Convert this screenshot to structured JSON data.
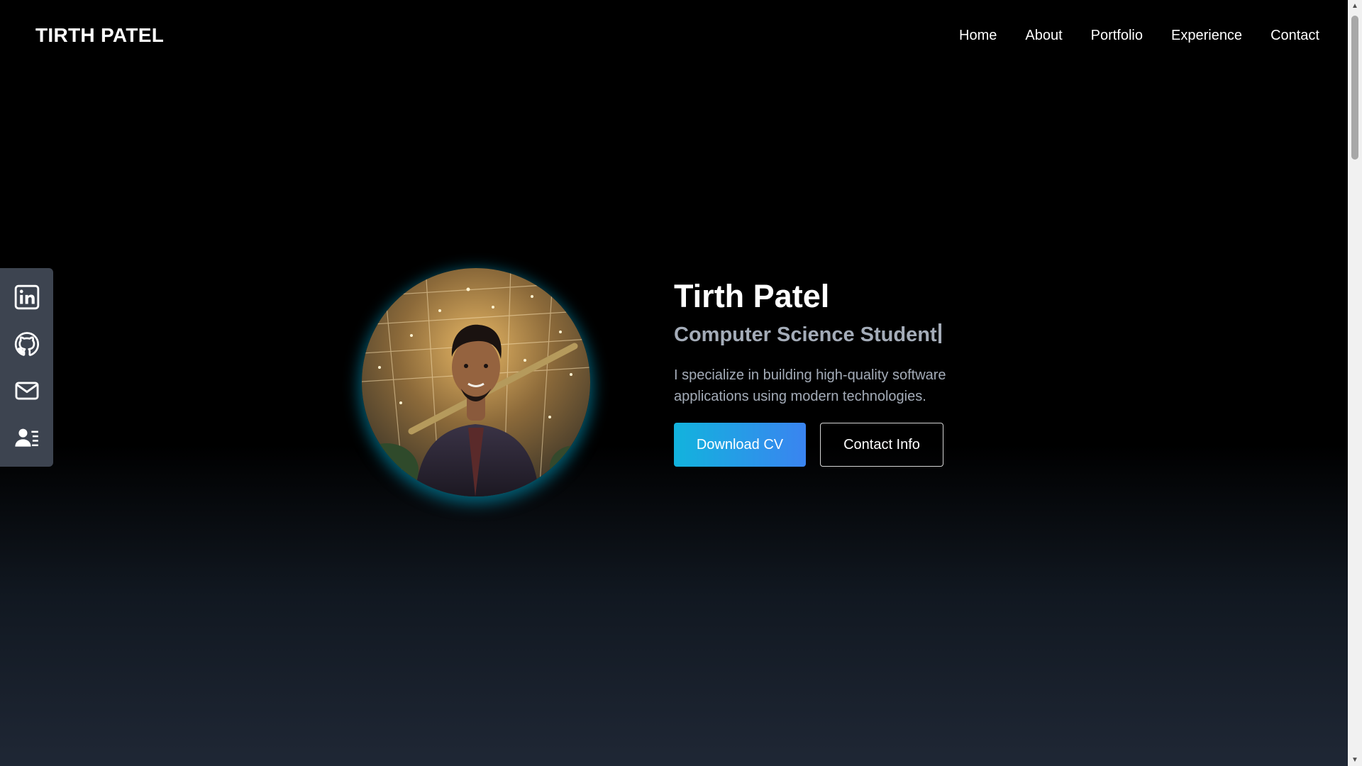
{
  "header": {
    "logo": "TIRTH PATEL",
    "nav": [
      {
        "label": "Home"
      },
      {
        "label": "About"
      },
      {
        "label": "Portfolio"
      },
      {
        "label": "Experience"
      },
      {
        "label": "Contact"
      }
    ]
  },
  "social": [
    {
      "icon": "linkedin-icon"
    },
    {
      "icon": "github-icon"
    },
    {
      "icon": "mail-icon"
    },
    {
      "icon": "contact-card-icon"
    }
  ],
  "hero": {
    "name": "Tirth Patel",
    "role": "Computer Science Student",
    "description": "I specialize in building high-quality software applications using modern technologies.",
    "primary_button": "Download CV",
    "secondary_button": "Contact Info"
  },
  "colors": {
    "accent_start": "#12b3dd",
    "accent_end": "#3a84f0",
    "muted_text": "#a4acb8",
    "sidebar_bg": "#3d4450"
  }
}
